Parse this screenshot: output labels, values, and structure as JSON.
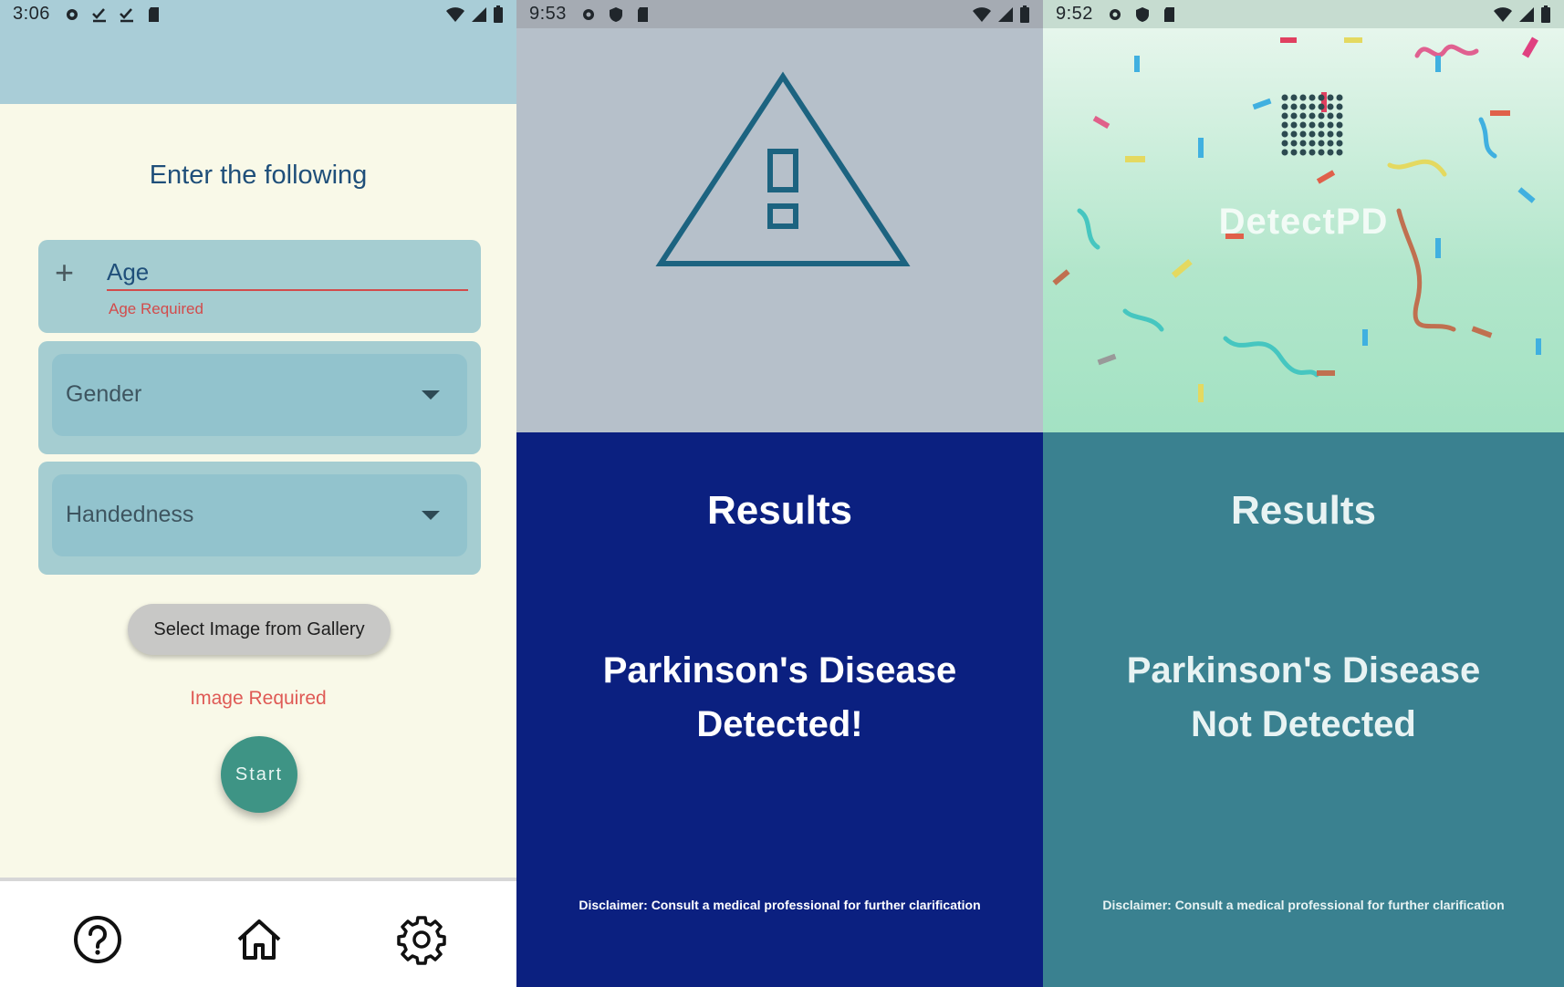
{
  "screen1": {
    "status_time": "3:06",
    "heading": "Enter the following",
    "age_label": "Age",
    "age_error": "Age Required",
    "gender_label": "Gender",
    "handedness_label": "Handedness",
    "gallery_button": "Select Image from Gallery",
    "image_error": "Image Required",
    "start_button": "Start",
    "nav": [
      "help-icon",
      "home-icon",
      "settings-icon"
    ]
  },
  "screen2": {
    "status_time": "9:53",
    "title": "Results",
    "line1": "Parkinson's Disease",
    "line2": "Detected!",
    "disclaimer": "Disclaimer: Consult a medical professional for further clarification",
    "bg_color": "#0b2080"
  },
  "screen3": {
    "status_time": "9:52",
    "brand": "DetectPD",
    "title": "Results",
    "line1": "Parkinson's Disease",
    "line2": "Not Detected",
    "disclaimer": "Disclaimer: Consult a medical professional for further clarification",
    "bg_color": "#3a8190"
  },
  "colors": {
    "error": "#d24b4b",
    "accent": "#3e9485",
    "heading": "#1f4f7a"
  }
}
